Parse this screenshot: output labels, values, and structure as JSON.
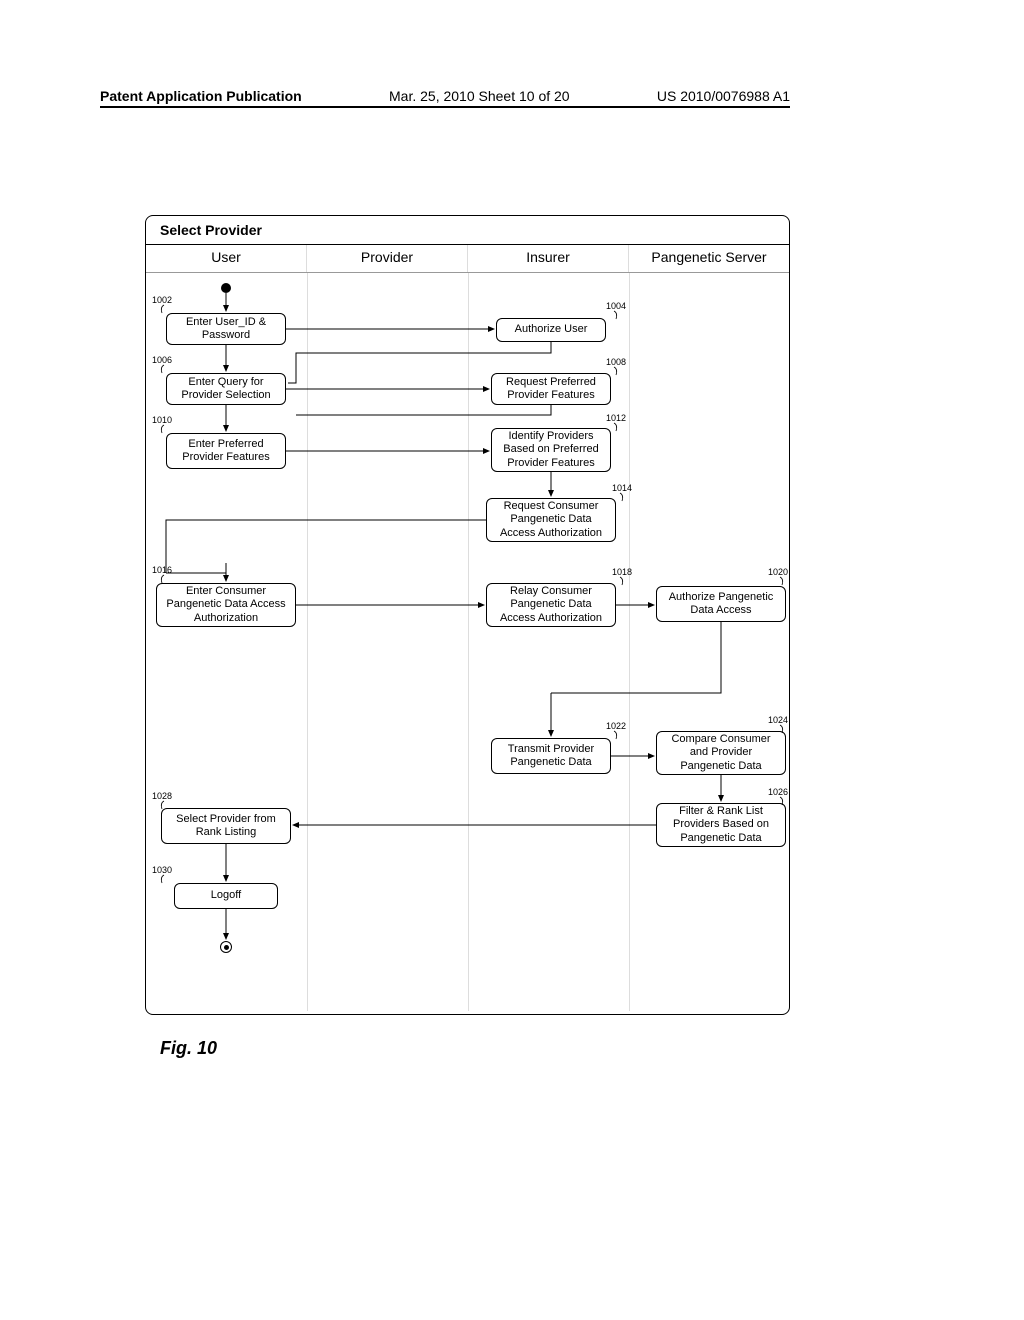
{
  "header": {
    "left": "Patent Application Publication",
    "center": "Mar. 25, 2010  Sheet 10 of 20",
    "right": "US 2010/0076988 A1"
  },
  "figure_caption": "Fig. 10",
  "diagram": {
    "title": "Select Provider",
    "lanes": [
      "User",
      "Provider",
      "Insurer",
      "Pangenetic Server"
    ]
  },
  "boxes": {
    "b1002": "Enter User_ID & Password",
    "b1004": "Authorize User",
    "b1006": "Enter Query for Provider Selection",
    "b1008": "Request Preferred Provider Features",
    "b1010": "Enter Preferred Provider Features",
    "b1012": "Identify Providers Based on Preferred Provider Features",
    "b1014": "Request Consumer Pangenetic Data Access Authorization",
    "b1016": "Enter Consumer Pangenetic Data Access Authorization",
    "b1018": "Relay Consumer Pangenetic Data Access Authorization",
    "b1020": "Authorize Pangenetic Data Access",
    "b1022": "Transmit Provider Pangenetic Data",
    "b1024": "Compare Consumer and Provider Pangenetic Data",
    "b1026": "Filter & Rank List Providers Based on Pangenetic Data",
    "b1028": "Select Provider from Rank Listing",
    "b1030": "Logoff"
  },
  "refs": {
    "r1002": "1002",
    "r1004": "1004",
    "r1006": "1006",
    "r1008": "1008",
    "r1010": "1010",
    "r1012": "1012",
    "r1014": "1014",
    "r1016": "1016",
    "r1018": "1018",
    "r1020": "1020",
    "r1022": "1022",
    "r1024": "1024",
    "r1026": "1026",
    "r1028": "1028",
    "r1030": "1030"
  }
}
